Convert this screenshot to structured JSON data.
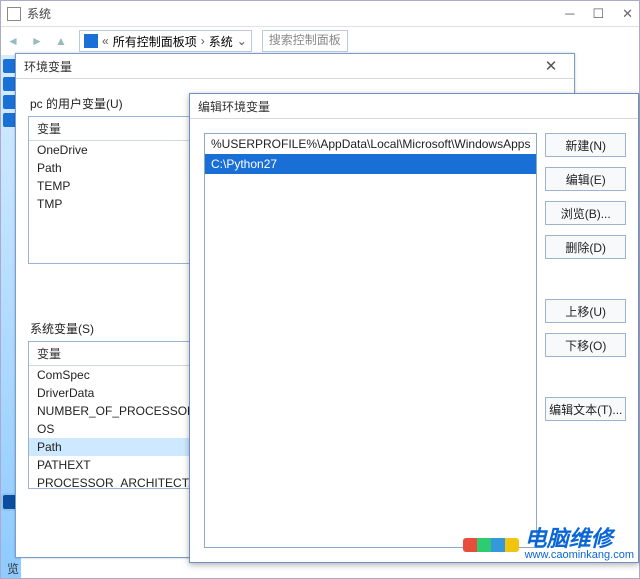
{
  "bg_window": {
    "title": "系统",
    "crumb_item1": "所有控制面板项",
    "crumb_item2": "系统",
    "search_placeholder": "搜索控制面板",
    "bottom_label": "览"
  },
  "env_dialog": {
    "title": "环境变量",
    "user_group_label": "pc 的用户变量(U)",
    "list_header": "变量",
    "user_vars": [
      "OneDrive",
      "Path",
      "TEMP",
      "TMP"
    ],
    "sys_group_label": "系统变量(S)",
    "sys_vars": [
      "ComSpec",
      "DriverData",
      "NUMBER_OF_PROCESSORS",
      "OS",
      "Path",
      "PATHEXT",
      "PROCESSOR_ARCHITECT..."
    ]
  },
  "edit_dialog": {
    "title": "编辑环境变量",
    "entries": [
      "%USERPROFILE%\\AppData\\Local\\Microsoft\\WindowsApps",
      "C:\\Python27"
    ],
    "selected_index": 1,
    "buttons": {
      "new": "新建(N)",
      "edit": "编辑(E)",
      "browse": "浏览(B)...",
      "delete": "删除(D)",
      "move_up": "上移(U)",
      "move_down": "下移(O)",
      "edit_text": "编辑文本(T)..."
    }
  },
  "watermark": {
    "cn": "电脑维修",
    "url": "www.caominkang.com"
  }
}
